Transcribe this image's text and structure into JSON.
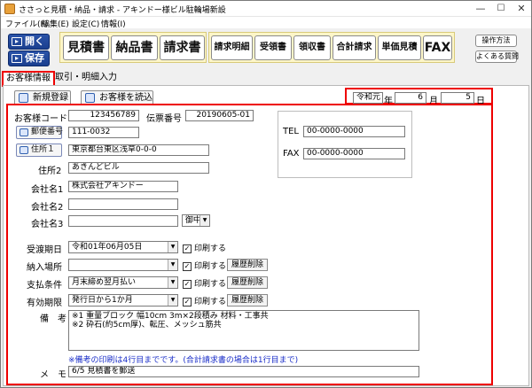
{
  "window": {
    "title": "ささっと見積・納品・請求 - アキンドー様ビル駐輪場新設"
  },
  "menu": [
    "ファイル(F)",
    "編集(E)",
    "設定(C)",
    "情報(I)"
  ],
  "toolbar": {
    "open_label": "開く",
    "save_label": "保存",
    "buttons": [
      "見積書",
      "納品書",
      "請求書",
      "請求明細",
      "受領書",
      "領収書",
      "合計請求",
      "単価見積",
      "FAX"
    ],
    "help": "操作方法",
    "faq": "よくある質問"
  },
  "tabs": [
    "お客様情報",
    "取引・明細入力"
  ],
  "actions": {
    "new": "新規登録",
    "load": "お客様を読込"
  },
  "date": {
    "era": "令和元",
    "year_unit": "年",
    "month": "6",
    "month_unit": "月",
    "day": "5",
    "day_unit": "日"
  },
  "form": {
    "customer_code_label": "お客様コード",
    "customer_code": "123456789",
    "slip_label": "伝票番号",
    "slip": "20190605-01",
    "postal_btn": "郵便番号",
    "postal": "111-0032",
    "addr1_btn": "住所１",
    "addr1": "東京都台東区浅草0-0-0",
    "addr2_label": "住所2",
    "addr2": "あきんどビル",
    "company1_label": "会社名1",
    "company1": "株式会社アキンドー",
    "company2_label": "会社名2",
    "company2": "",
    "company3_label": "会社名3",
    "company3": "",
    "honorific": "御中",
    "tel_label": "TEL",
    "tel": "00-0000-0000",
    "fax_label": "FAX",
    "fax": "00-0000-0000",
    "delivery_date_label": "受渡期日",
    "delivery_date": "令和01年06月05日",
    "place_label": "納入場所",
    "place": "",
    "payment_label": "支払条件",
    "payment": "月末締め翌月払い",
    "validity_label": "有効期限",
    "validity": "発行日から1か月",
    "print_label": "印刷する",
    "history_delete": "履歴削除",
    "remarks_label": "備　考",
    "remarks_line1": "※1 重量ブロック 幅10cm 3m×2段積み 材料・工事共",
    "remarks_line2": "※2 砕石(約5cm厚)、転圧、メッシュ筋共",
    "remarks_note": "※備考の印刷は4行目までです。(合計請求書の場合は1行目まで)",
    "memo_label": "メ　モ",
    "memo": "6/5 見積書を郵送"
  }
}
